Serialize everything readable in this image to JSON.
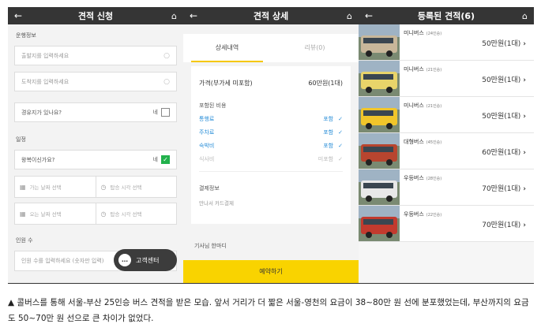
{
  "screen1": {
    "back_icon": "←",
    "title": "견적 신청",
    "home_icon": "⌂",
    "section_route": "운행정보",
    "departure_placeholder": "출발지를 입력하세요",
    "arrival_placeholder": "도착지를 입력하세요",
    "waypoint_question": "경유지가 있나요?",
    "waypoint_answer": "네",
    "section_schedule": "일정",
    "roundtrip_question": "왕복이신가요?",
    "roundtrip_answer": "네",
    "go_date": "가는 날짜 선택",
    "go_time": "탑승 시각 선택",
    "return_date": "오는 날짜 선택",
    "return_time": "탑승 시각 선택",
    "section_people": "인원 수",
    "people_placeholder": "인원 수를 입력하세요 (숫자만 입력)",
    "customer_center": "고객센터"
  },
  "screen2": {
    "back_icon": "←",
    "title": "견적 상세",
    "home_icon": "⌂",
    "tab_detail": "상세내역",
    "tab_review": "리뷰(0)",
    "price_label": "가격(부가세 미포함)",
    "price_value": "60만원(1대)",
    "included_label": "포함된 비용",
    "costs": [
      {
        "name": "통행료",
        "status": "포함",
        "included": true
      },
      {
        "name": "주차료",
        "status": "포함",
        "included": true
      },
      {
        "name": "숙박비",
        "status": "포함",
        "included": true
      },
      {
        "name": "식사비",
        "status": "미포함",
        "included": false
      }
    ],
    "payment_label": "결제정보",
    "payment_value": "만나서 카드결제",
    "driver_label": "기사님 한마디",
    "reserve_button": "예약하기"
  },
  "screen3": {
    "back_icon": "←",
    "title": "등록된 견적(6)",
    "home_icon": "⌂",
    "buses": [
      {
        "name": "미니버스",
        "seats": "(24인승)",
        "price": "50만원(1대)",
        "color": "#c8b79a"
      },
      {
        "name": "미니버스",
        "seats": "(21인승)",
        "price": "50만원(1대)",
        "color": "#e8d46a"
      },
      {
        "name": "미니버스",
        "seats": "(21인승)",
        "price": "50만원(1대)",
        "color": "#f1c52a"
      },
      {
        "name": "대형버스",
        "seats": "(45인승)",
        "price": "60만원(1대)",
        "color": "#b8452f"
      },
      {
        "name": "우등버스",
        "seats": "(28인승)",
        "price": "70만원(1대)",
        "color": "#e8e8e8"
      },
      {
        "name": "우등버스",
        "seats": "(22인승)",
        "price": "70만원(1대)",
        "color": "#c23a2e"
      }
    ]
  },
  "caption": "▲ 콜버스를 통해 서울-부산 25인승 버스 견적을 받은 모습. 앞서 거리가 더 짧은 서울-영천의 요금이 38~80만 원 선에 분포했었는데, 부산까지의 요금도 50~70만 원 선으로 큰 차이가 없었다."
}
